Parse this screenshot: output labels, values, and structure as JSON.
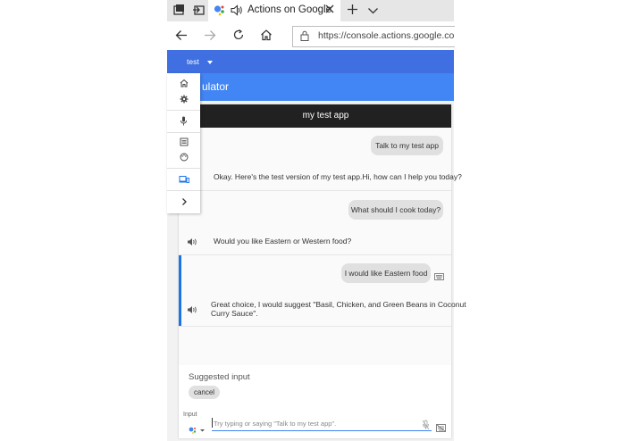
{
  "browser": {
    "tab_title": "Actions on Google",
    "url": "https://console.actions.google.com/p",
    "icons": {
      "tab_manager": "tabs-icon",
      "set_aside": "set-aside-icon",
      "speaker": "speaker-icon",
      "close": "close-icon",
      "new_tab": "plus-icon",
      "tab_list": "chevron-down-icon",
      "back": "back-icon",
      "forward": "forward-icon",
      "refresh": "refresh-icon",
      "home": "home-icon",
      "lock": "lock-icon"
    }
  },
  "app": {
    "project_name": "test",
    "page_title_partial": "ulator",
    "app_name": "my test app"
  },
  "conversation": [
    {
      "user": "Talk to my test app",
      "response": "Okay. Here's the test version of my test app.Hi, how can I help you today?"
    },
    {
      "user": "What should I cook today?",
      "response": "Would you like Eastern or Western food?"
    },
    {
      "user": "I would like Eastern food",
      "response_line1": "Great choice, I would suggest \"Basil, Chicken, and Green Beans in Coconut",
      "response_line2": "Curry Sauce\"."
    }
  ],
  "suggestions": {
    "label": "Suggested input",
    "chips": [
      "cancel"
    ]
  },
  "input": {
    "label": "Input",
    "placeholder": "Try typing or saying \"Talk to my test app\"."
  },
  "colors": {
    "accent_blue": "#4285f4",
    "top_strip_blue": "#3f6fe0",
    "selected_border": "#1a73e8",
    "header_dark": "#212121"
  }
}
